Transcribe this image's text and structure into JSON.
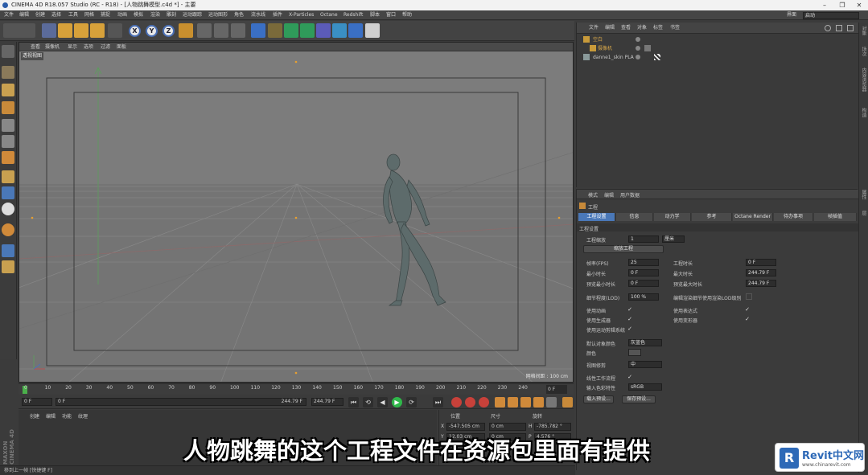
{
  "window": {
    "title": "CINEMA 4D R18.057 Studio (RC - R18) - [人物跳舞模型.c4d *] - 主要",
    "minimize": "–",
    "maximize": "❐",
    "close": "✕"
  },
  "menubar": {
    "items": [
      "文件",
      "编辑",
      "创建",
      "选择",
      "工具",
      "网格",
      "捕捉",
      "动画",
      "模拟",
      "渲染",
      "雕刻",
      "运动跟踪",
      "运动图形",
      "角色",
      "流水线",
      "插件",
      "X-Particles",
      "Octane",
      "Redshift",
      "脚本",
      "窗口",
      "帮助"
    ],
    "layout_label": "界面",
    "layout_value": "启动"
  },
  "toolbar": {
    "axis_x": "X",
    "axis_y": "Y",
    "axis_z": "Z"
  },
  "viewport": {
    "menu": [
      "查看",
      "摄像机",
      "显示",
      "选项",
      "过滤",
      "面板"
    ],
    "title": "透视视图",
    "grid_spacing": "网格间距 : 100 cm"
  },
  "timeline": {
    "ticks": [
      "0",
      "10",
      "20",
      "30",
      "40",
      "50",
      "60",
      "70",
      "80",
      "90",
      "100",
      "110",
      "120",
      "130",
      "140",
      "150",
      "160",
      "170",
      "180",
      "190",
      "200",
      "210",
      "220",
      "230",
      "240"
    ],
    "end_value": "0 F",
    "current_frame": 0,
    "max_frame": 240
  },
  "transport": {
    "start_field": "0 F",
    "range_start": "0 F",
    "range_end": "244.79 F",
    "end_field": "244.79 F",
    "buttons": [
      "⏮",
      "⟲",
      "◀",
      "▶",
      "⟳",
      "⏭"
    ]
  },
  "material_panel": {
    "tabs": [
      "创建",
      "编辑",
      "功能",
      "纹理"
    ]
  },
  "coord_panel": {
    "headers": [
      "位置",
      "尺寸",
      "旋转"
    ],
    "row1": {
      "axis": "X",
      "position": "-547.505 cm",
      "size": "0 cm",
      "rot_axis": "H",
      "rotation": "-785.782 °"
    },
    "row2": {
      "axis": "Y",
      "position": "12.03 cm",
      "size": "0 cm",
      "rot_axis": "P",
      "rotation": "4.576 °"
    }
  },
  "object_manager": {
    "menu": [
      "文件",
      "编辑",
      "查看",
      "对象",
      "标签",
      "书签"
    ],
    "objects": [
      {
        "name": "空白",
        "color": "#d6a64a",
        "indent": 0
      },
      {
        "name": "摄像机",
        "color": "#d6a64a",
        "indent": 1
      },
      {
        "name": "danne1_skin PLA",
        "color": "#c8c8c8",
        "indent": 0
      }
    ]
  },
  "attribute_manager": {
    "menu": [
      "模式",
      "编辑",
      "用户数据"
    ],
    "object_type": "工程",
    "tabs": [
      "工程设置",
      "信息",
      "动力学",
      "参考",
      "Octane Render",
      "待办事项",
      "帧插值"
    ],
    "active_tab": 0,
    "section": "工程设置",
    "scale_label": "工程缩放",
    "scale_value": "1",
    "scale_unit": "厘米",
    "scale_button": "缩放工程",
    "fps_label": "帧率(FPS)",
    "fps_value": "25",
    "project_time_label": "工程时长",
    "project_time_value": "0 F",
    "min_time_label": "最小时长",
    "min_time_value": "0 F",
    "max_time_label": "最大时长",
    "max_time_value": "244.79 F",
    "preview_min_label": "预览最小时长",
    "preview_min_value": "0 F",
    "preview_max_label": "预览最大时长",
    "preview_max_value": "244.79 F",
    "lod_label": "细节程度(LOD)",
    "lod_value": "100 %",
    "render_lod_label": "编辑渲染细节使用渲染LOD级别",
    "use_anim_label": "使用动画",
    "use_expr_label": "使用表达式",
    "use_gen_label": "使用生成器",
    "use_deform_label": "使用变形器",
    "use_motion_label": "使用运动剪辑系统",
    "default_color_label": "默认对象颜色",
    "default_color_value": "灰蓝色",
    "color_label": "颜色",
    "view_clip_label": "视图修剪",
    "view_clip_value": "中",
    "linear_workflow_label": "线性工作流程",
    "input_color_label": "输入色彩特性",
    "input_color_value": "sRGB",
    "load_preset": "载入预设...",
    "save_preset": "保存预设...",
    "check": "✓"
  },
  "right_strip": [
    "对象",
    "场次",
    "内容浏览器",
    "构造",
    "属性",
    "层"
  ],
  "status": "移到上一帧 [快捷键 F]",
  "maxon": "MAXON CINEMA 4D",
  "subtitle": "人物跳舞的这个工程文件在资源包里面有提供",
  "watermark": {
    "logo": "R",
    "brand": "Revit中文网",
    "url": "www.chinarevit.com"
  },
  "colors": {
    "accent": "#4a78b8",
    "play": "#2fb84a",
    "record": "#d33a3a",
    "grid_y_axis": "#4bb04b",
    "grid_x_axis": "#c94a4a"
  }
}
